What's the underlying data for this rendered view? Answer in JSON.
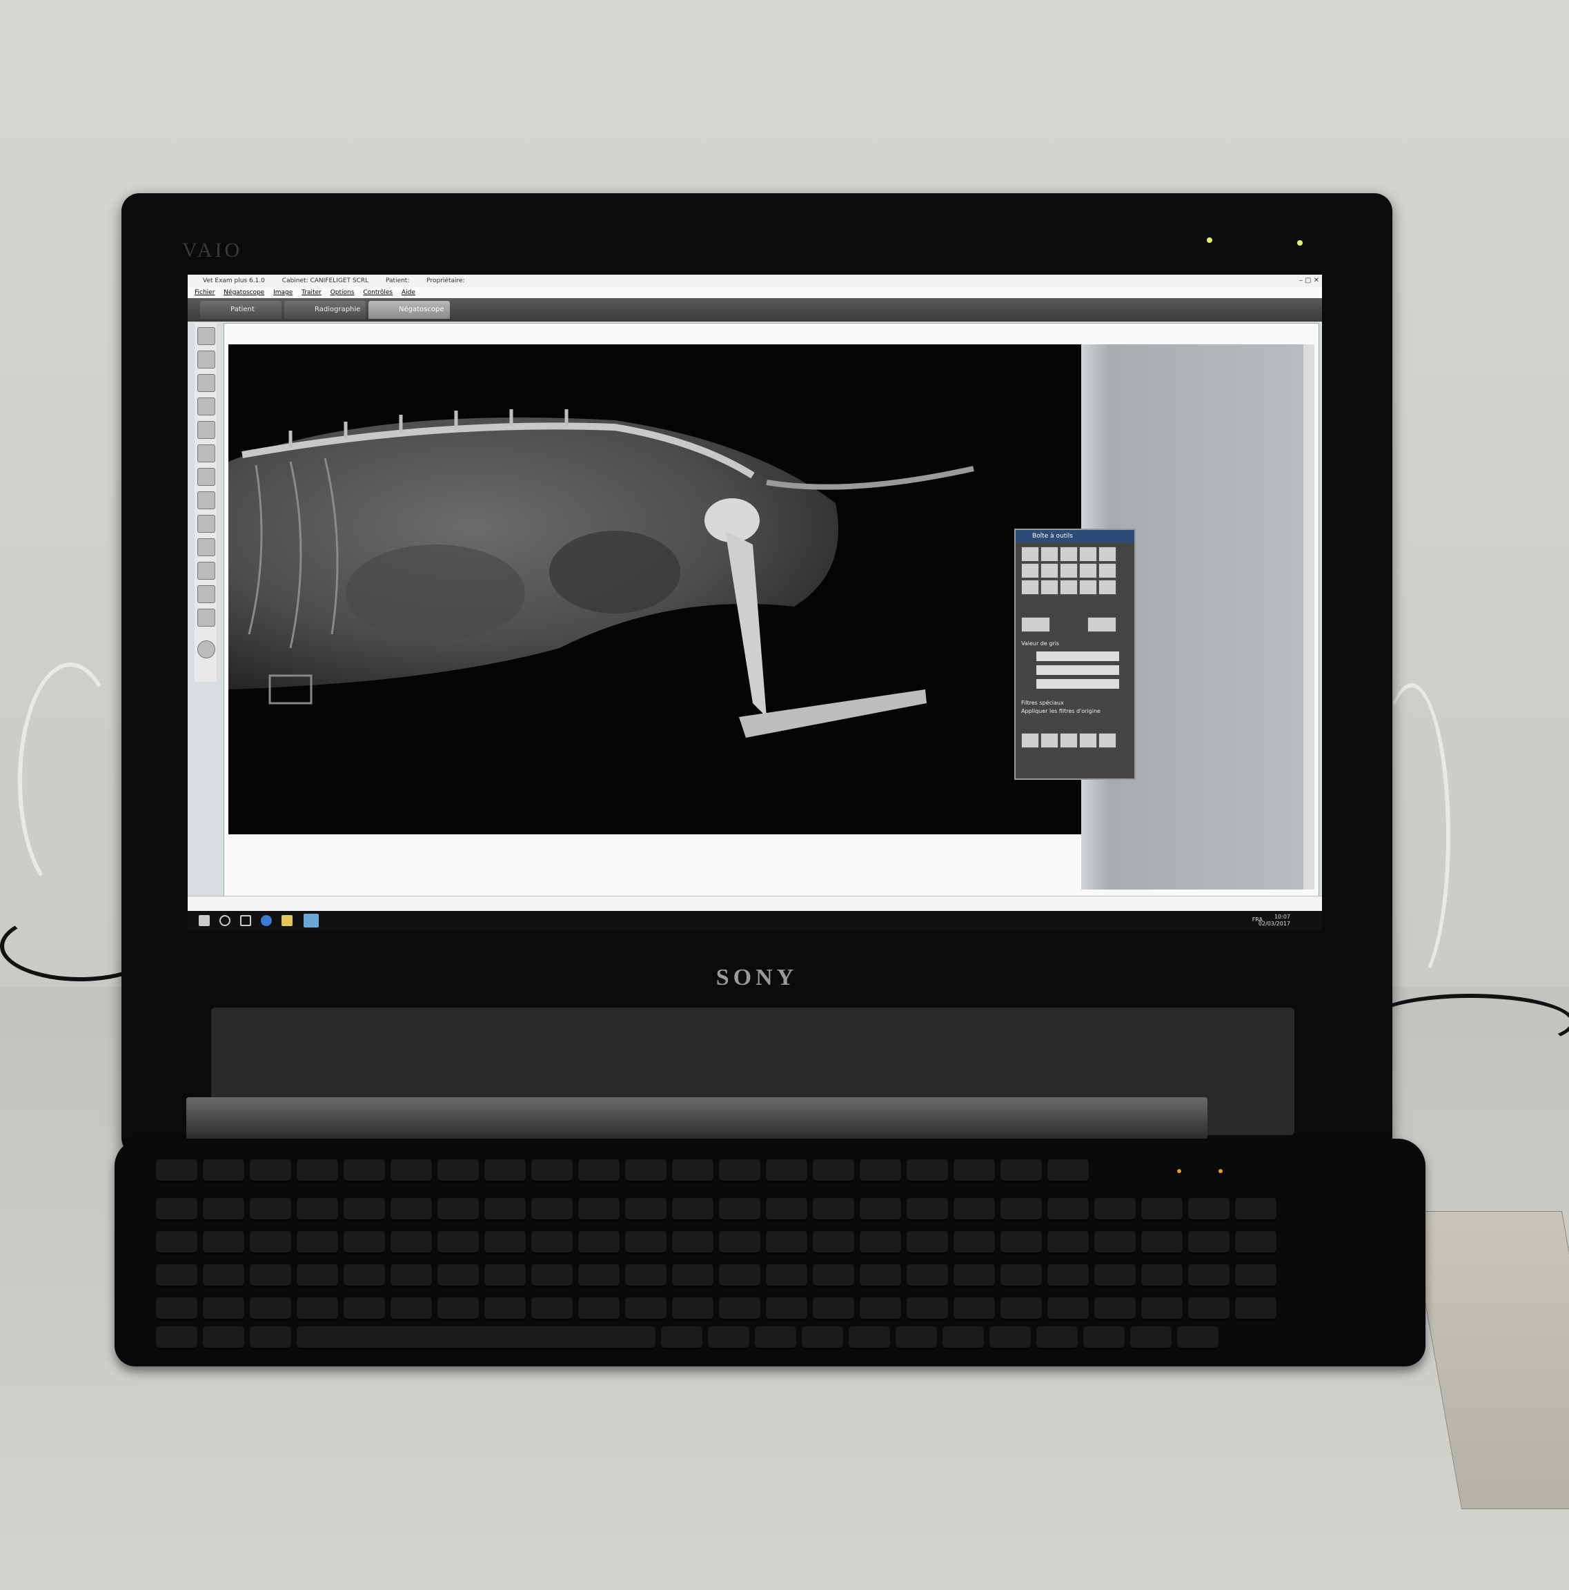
{
  "monitor": {
    "brand_top": "VAIO",
    "brand_bottom": "SONY"
  },
  "app": {
    "title_items": [
      "Vet Exam plus 6.1.0",
      "Cabinet: CANIFELIGET SCRL",
      "Patient: ",
      "Propriétaire: "
    ],
    "menu": [
      "Fichier",
      "Négatoscope",
      "Image",
      "Traiter",
      "Options",
      "Contrôles",
      "Aide"
    ],
    "tabs": [
      {
        "label": "Patient",
        "active": false
      },
      {
        "label": "Radiographie",
        "active": false
      },
      {
        "label": "Négatoscope",
        "active": true
      }
    ],
    "window_controls": "– ▢ ✕"
  },
  "document": {
    "title": ""
  },
  "palette": {
    "title": "Boîte à outils",
    "section_gray": "Valeur de gris",
    "section_filters": "Filtres spéciaux",
    "checkbox_label": "Appliquer les filtres d'origine",
    "footer_left": "",
    "footer_right": ""
  },
  "taskbar": {
    "language": "FRA",
    "time": "10:07",
    "date": "02/03/2017"
  },
  "colors": {
    "screen_bg": "#d8dde0",
    "xray_bg": "#050505",
    "palette_title": "#2c4d7a"
  }
}
